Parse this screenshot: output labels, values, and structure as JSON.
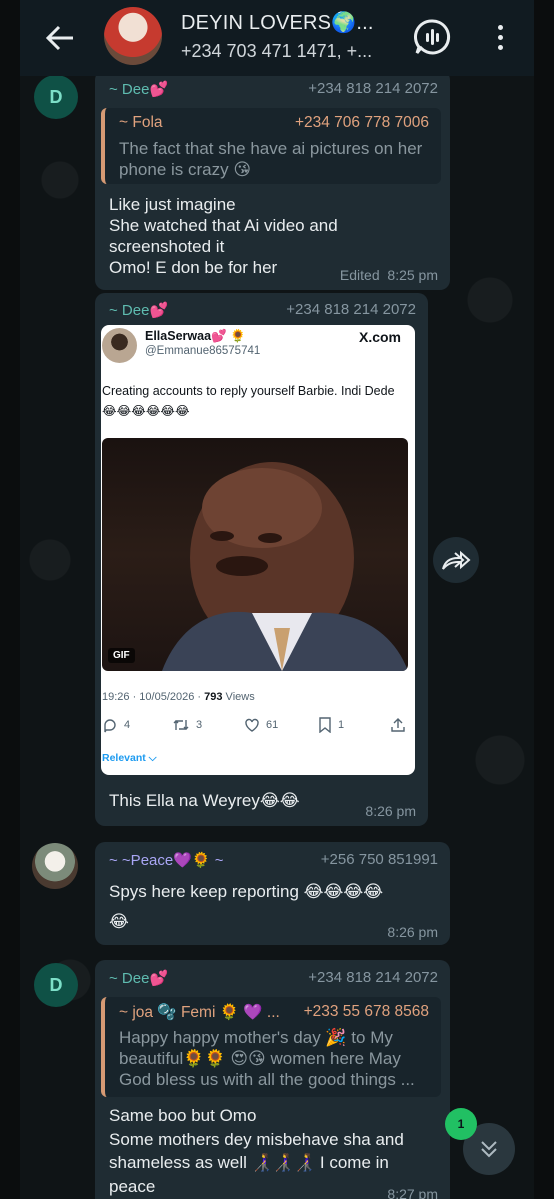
{
  "header": {
    "title": "DEYIN LOVERS🌍...",
    "subtitle": "+234 703 471 1471, +..."
  },
  "messages": [
    {
      "avatar_letter": "D",
      "sender": "~ Dee💕",
      "phone": "+234 818 214 2072",
      "quote": {
        "sender": "~ Fola",
        "phone": "+234 706 778 7006",
        "text": "The fact that she have ai pictures on her phone is crazy 😘"
      },
      "lines": [
        "Like just imagine",
        "She watched that Ai video and",
        "screenshoted it",
        "Omo! E don be for her"
      ],
      "status": "Edited",
      "time": "8:25 pm"
    },
    {
      "sender": "~ Dee💕",
      "phone": "+234 818 214 2072",
      "tweet": {
        "name": "EllaSerwaa💕 🌻",
        "handle": "@Emmanue86575741",
        "brand": "X.com",
        "text": "Creating accounts to reply yourself Barbie. Indi Dede😂😂😂😂😂😂",
        "gif_label": "GIF",
        "timestamp": "19:26 · 10/05/2026 · ",
        "views_count": "793",
        "views_label": " Views",
        "replies": "4",
        "retweets": "3",
        "likes": "61",
        "bookmarks": "1",
        "relevant": "Relevant ⌵"
      },
      "text": "This Ella na Weyrey😂😂",
      "time": "8:26 pm"
    },
    {
      "sender": "~ ~Peace💜🌻 ~",
      "phone": "+256 750 851991",
      "lines": [
        "Spys here keep reporting 😂😂😂😂",
        "😂"
      ],
      "time": "8:26 pm"
    },
    {
      "avatar_letter": "D",
      "sender": "~ Dee💕",
      "phone": "+234 818 214 2072",
      "quote": {
        "sender": "~ joa 🫧 Femi 🌻 💜 ...",
        "phone": "+233 55 678 8568",
        "text": "Happy happy mother's day 🎉 to My beautiful🌻🌻 😍😘 women here May God bless us with all the good things ..."
      },
      "lines": [
        "Same boo but Omo",
        "Some mothers dey misbehave sha and",
        "shameless as well 👩‍🦯👩‍🦯👩‍🦯 I come in",
        "peace"
      ],
      "time": "8:27 pm"
    }
  ],
  "unread_count": "1",
  "colors": {
    "accent": "#5fbcb0",
    "bubble": "#1f2c33",
    "badge": "#21c063"
  }
}
